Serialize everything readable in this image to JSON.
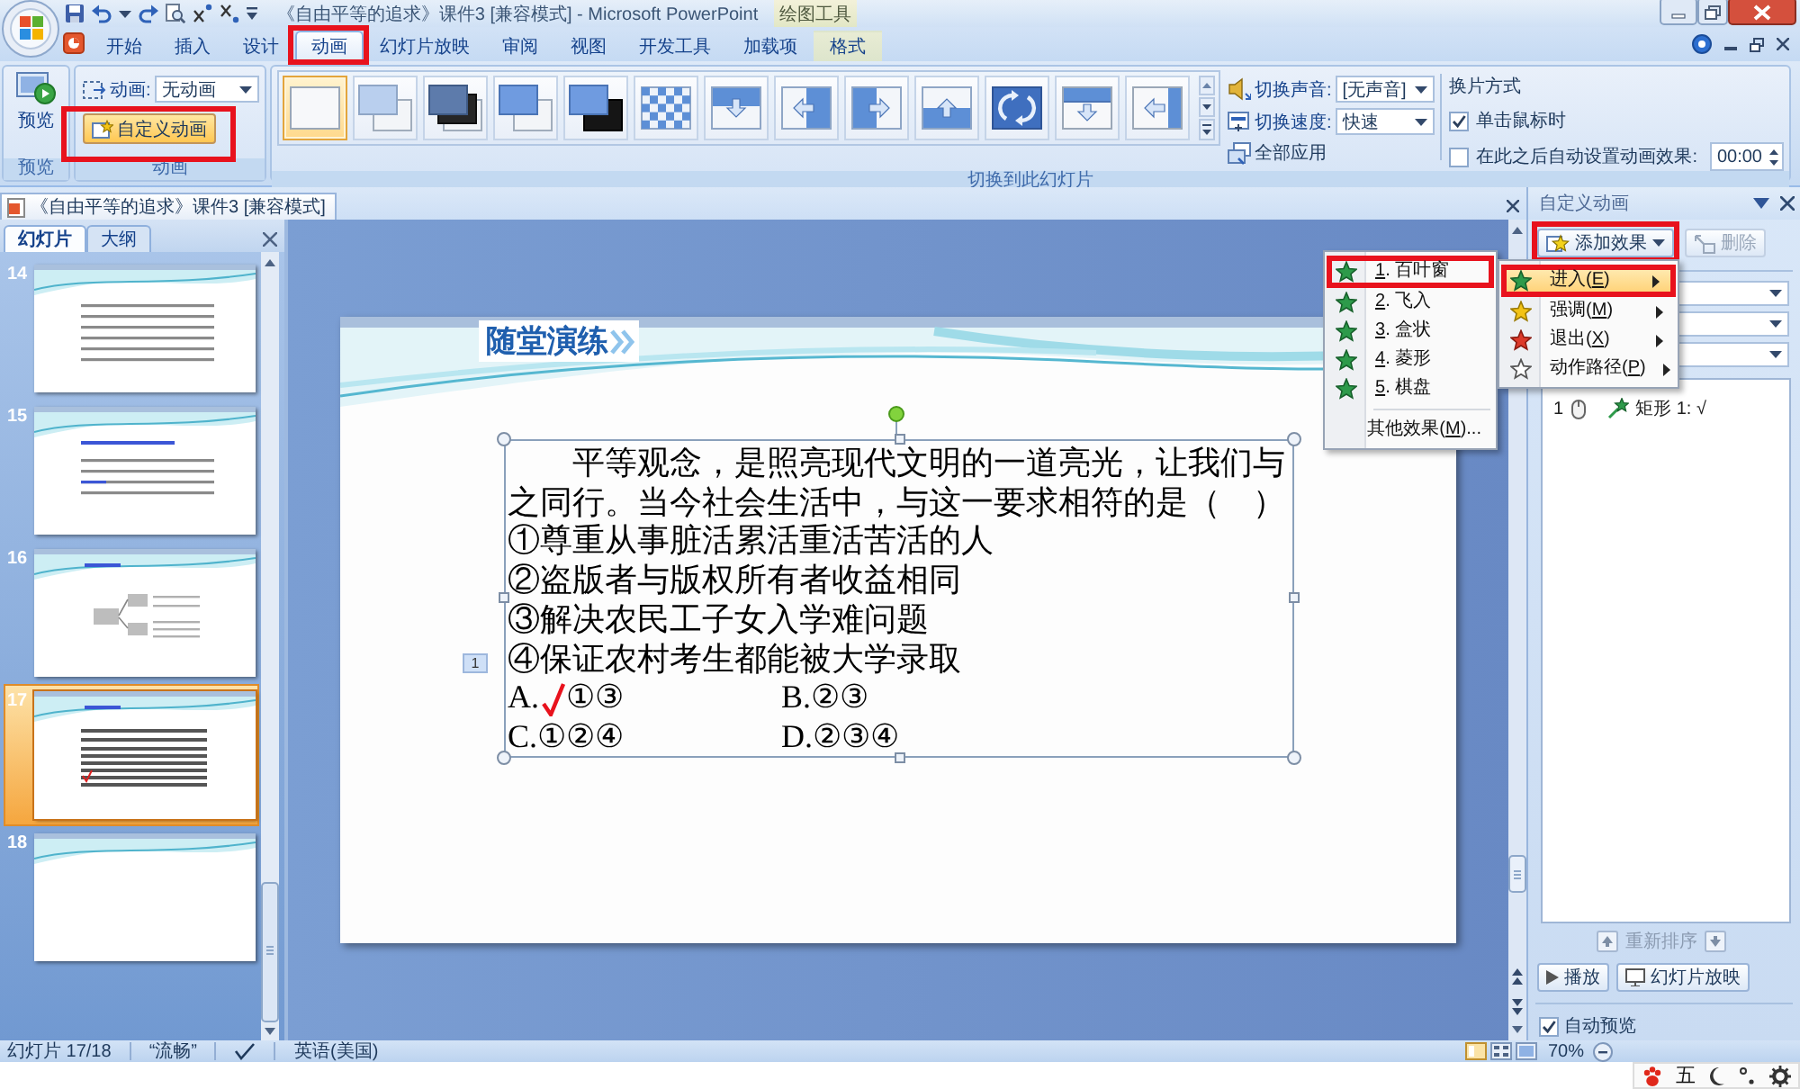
{
  "title_bar": {
    "title": "《自由平等的追求》课件3 [兼容模式] - Microsoft PowerPoint",
    "context_label": "绘图工具"
  },
  "ribbon_tabs": [
    {
      "label": "开始",
      "kind": "main",
      "selected": false,
      "highlighted": false
    },
    {
      "label": "插入",
      "kind": "main",
      "selected": false,
      "highlighted": false
    },
    {
      "label": "设计",
      "kind": "main",
      "selected": false,
      "highlighted": false
    },
    {
      "label": "动画",
      "kind": "main",
      "selected": true,
      "highlighted": true
    },
    {
      "label": "幻灯片放映",
      "kind": "main",
      "selected": false,
      "highlighted": false
    },
    {
      "label": "审阅",
      "kind": "main",
      "selected": false,
      "highlighted": false
    },
    {
      "label": "视图",
      "kind": "main",
      "selected": false,
      "highlighted": false
    },
    {
      "label": "开发工具",
      "kind": "main",
      "selected": false,
      "highlighted": false
    },
    {
      "label": "加载项",
      "kind": "main",
      "selected": false,
      "highlighted": false
    },
    {
      "label": "格式",
      "kind": "contextual",
      "selected": false,
      "highlighted": false
    }
  ],
  "ribbon": {
    "preview": {
      "button": "预览",
      "group_label": "预览"
    },
    "animations": {
      "field_label": "动画:",
      "field_value": "无动画",
      "custom_button": {
        "label": "自定义动画",
        "highlighted": true
      },
      "group_label": "动画"
    },
    "transition": {
      "gallery": [
        {
          "kind": "blank",
          "selected": true
        },
        {
          "kind": "fade",
          "selected": false
        },
        {
          "kind": "fade-black",
          "selected": false
        },
        {
          "kind": "cut",
          "selected": false
        },
        {
          "kind": "cut-black",
          "selected": false
        },
        {
          "kind": "dissolve",
          "selected": false
        },
        {
          "kind": "wipe-down",
          "selected": false
        },
        {
          "kind": "wipe-left",
          "selected": false
        },
        {
          "kind": "wipe-right",
          "selected": false
        },
        {
          "kind": "wipe-up",
          "selected": false
        },
        {
          "kind": "wheel",
          "selected": false
        },
        {
          "kind": "cover-down",
          "selected": false
        },
        {
          "kind": "cover-left",
          "selected": false
        }
      ],
      "sound_label": "切换声音:",
      "sound_value": "[无声音]",
      "speed_label": "切换速度:",
      "speed_value": "快速",
      "apply_all": "全部应用",
      "advance_title": "换片方式",
      "on_click": {
        "label": "单击鼠标时",
        "checked": true
      },
      "after": {
        "label": "在此之后自动设置动画效果:",
        "checked": false,
        "value": "00:00"
      },
      "group_label": "切换到此幻灯片"
    }
  },
  "document_tab": {
    "title": "《自由平等的追求》课件3 [兼容模式]"
  },
  "slides_pane": {
    "tabs": [
      {
        "label": "幻灯片",
        "selected": true
      },
      {
        "label": "大纲",
        "selected": false
      }
    ],
    "slides": [
      {
        "number": "14",
        "kind": "text",
        "selected": false
      },
      {
        "number": "15",
        "kind": "heading-text",
        "selected": false
      },
      {
        "number": "16",
        "kind": "diagram",
        "selected": false
      },
      {
        "number": "17",
        "kind": "quiz",
        "selected": true
      },
      {
        "number": "18",
        "kind": "blank",
        "selected": false
      }
    ]
  },
  "slide": {
    "title": "随堂演练",
    "order_tag": "1",
    "question": "平等观念，是照亮现代文明的一道亮光，让我们与之同行。当今社会生活中，与这一要求相符的是（　）",
    "statements": [
      "①尊重从事脏活累活重活苦活的人",
      "②盗版者与版权所有者收益相同",
      "③解决农民工子女入学难问题",
      "④保证农村考生都能被大学录取"
    ],
    "options": [
      {
        "letter": "A.",
        "answer": "①③",
        "marked": true
      },
      {
        "letter": "B.",
        "answer": "②③",
        "marked": false
      },
      {
        "letter": "C.",
        "answer": "①②④",
        "marked": false
      },
      {
        "letter": "D.",
        "answer": "②③④",
        "marked": false
      }
    ]
  },
  "task_pane": {
    "title": "自定义动画",
    "add_effect": {
      "label": "添加效果",
      "highlighted": true
    },
    "remove": {
      "label": "删除",
      "disabled": true
    },
    "animations": [
      {
        "order": "1",
        "name": "矩形 1: √"
      }
    ],
    "reorder_label": "重新排序",
    "play_button": "播放",
    "slideshow_button": "幻灯片放映",
    "autopreview": {
      "label": "自动预览",
      "checked": true
    }
  },
  "effect_menu": {
    "categories": [
      {
        "kind": "entrance",
        "before": "进入(",
        "key": "E",
        "after": ")",
        "selected": true,
        "highlighted": true
      },
      {
        "kind": "emphasis",
        "before": "强调(",
        "key": "M",
        "after": ")",
        "selected": false,
        "highlighted": false
      },
      {
        "kind": "exit",
        "before": "退出(",
        "key": "X",
        "after": ")",
        "selected": false,
        "highlighted": false
      },
      {
        "kind": "path",
        "before": "动作路径(",
        "key": "P",
        "after": ")",
        "selected": false,
        "highlighted": false
      }
    ],
    "effects": [
      {
        "key": "1",
        "after": ". 百叶窗",
        "selected": false,
        "highlighted": true
      },
      {
        "key": "2",
        "after": ". 飞入",
        "selected": false,
        "highlighted": false
      },
      {
        "key": "3",
        "after": ". 盒状",
        "selected": false,
        "highlighted": false
      },
      {
        "key": "4",
        "after": ". 菱形",
        "selected": false,
        "highlighted": false
      },
      {
        "key": "5",
        "after": ". 棋盘",
        "selected": false,
        "highlighted": false
      }
    ],
    "more": {
      "before": "其他效果(",
      "key": "M",
      "after": ")..."
    }
  },
  "status_bar": {
    "slide_info": "幻灯片 17/18",
    "theme": "“流畅”",
    "language": "英语(美国)",
    "zoom": "70%"
  },
  "ime_bar": {
    "mode": "五"
  }
}
